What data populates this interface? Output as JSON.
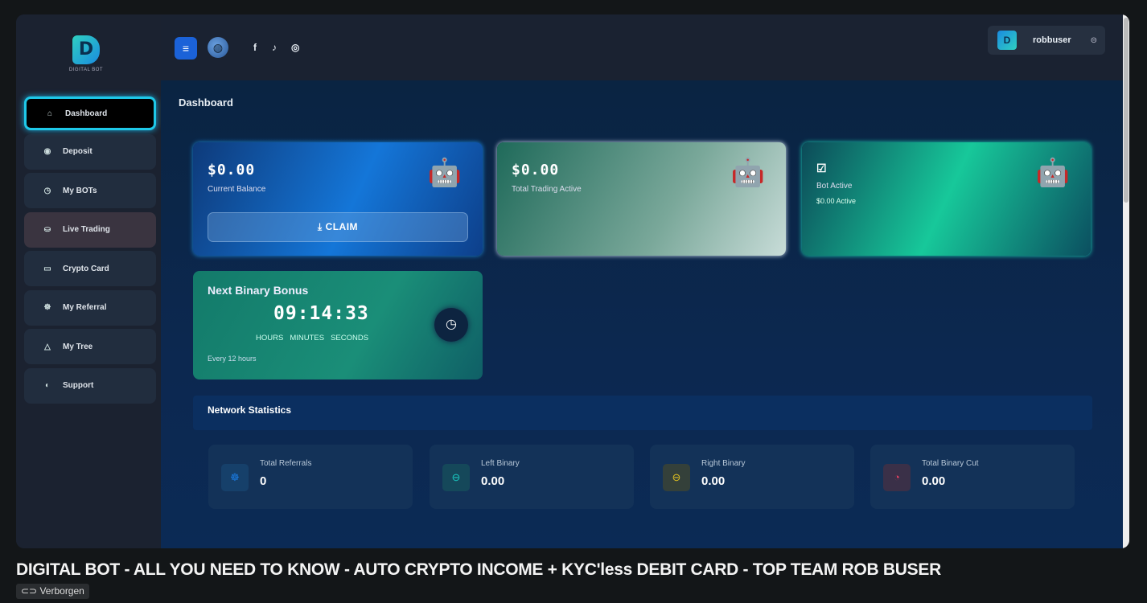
{
  "brand": {
    "logo_text": "DIGITAL BOT"
  },
  "topbar": {
    "menu_icon": "≡",
    "social": [
      "f",
      "♪",
      "◎"
    ],
    "username": "robbuser"
  },
  "sidebar": {
    "items": [
      {
        "icon": "⌂",
        "label": "Dashboard"
      },
      {
        "icon": "◉",
        "label": "Deposit"
      },
      {
        "icon": "◷",
        "label": "My BOTs"
      },
      {
        "icon": "⛀",
        "label": "Live Trading"
      },
      {
        "icon": "▭",
        "label": "Crypto Card"
      },
      {
        "icon": "☸",
        "label": "My Referral"
      },
      {
        "icon": "△",
        "label": "My Tree"
      },
      {
        "icon": "◐",
        "label": "Support"
      }
    ]
  },
  "main": {
    "title": "Dashboard",
    "balance": {
      "amount": "$0.00",
      "label": "Current Balance",
      "claim": "CLAIM"
    },
    "trading": {
      "amount": "$0.00",
      "label": "Total Trading Active"
    },
    "bot": {
      "label": "Bot Active",
      "sub": "$0.00 Active"
    },
    "binary": {
      "title": "Next Binary Bonus",
      "timer": "09:14:33",
      "units": [
        "HOURS",
        "MINUTES",
        "SECONDS"
      ],
      "note": "Every 12 hours"
    },
    "network": {
      "title": "Network Statistics",
      "stats": [
        {
          "label": "Total Referrals",
          "value": "0",
          "color": "#1a7ae0"
        },
        {
          "label": "Left Binary",
          "value": "0.00",
          "color": "#1ac8c0"
        },
        {
          "label": "Right Binary",
          "value": "0.00",
          "color": "#e0c020"
        },
        {
          "label": "Total Binary Cut",
          "value": "0.00",
          "color": "#e04060"
        }
      ]
    }
  },
  "video": {
    "title": "DIGITAL BOT - ALL YOU NEED TO KNOW - AUTO CRYPTO INCOME + KYC'less DEBIT CARD - TOP TEAM ROB BUSER",
    "visibility": "Verborgen"
  }
}
